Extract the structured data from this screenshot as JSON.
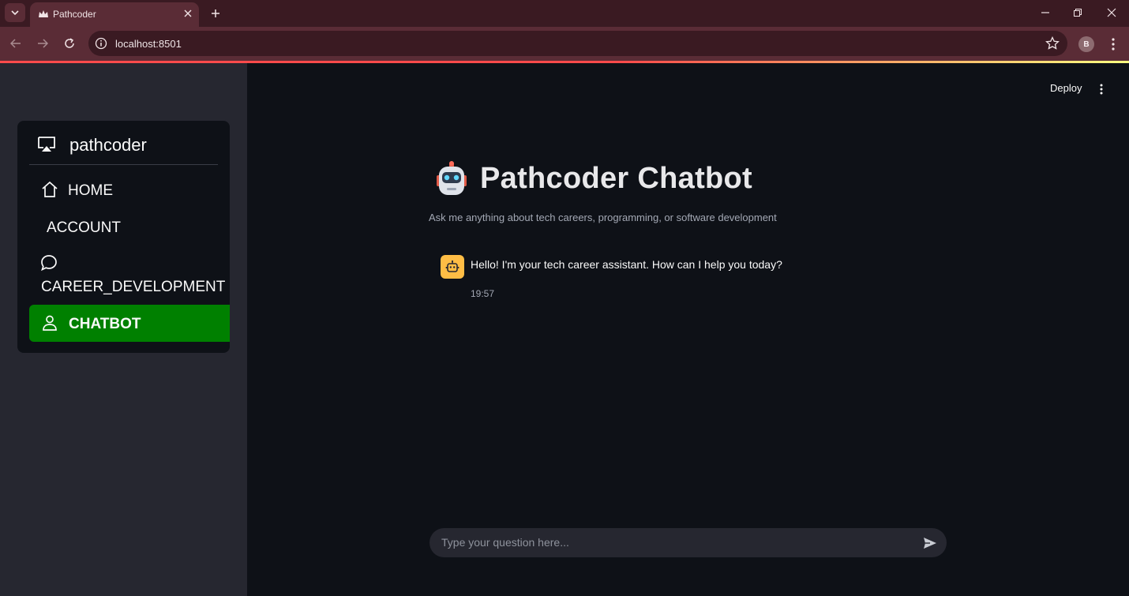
{
  "browser": {
    "tab_title": "Pathcoder",
    "url": "localhost:8501",
    "profile_initial": "B"
  },
  "sidebar": {
    "menu_title": "pathcoder",
    "items": [
      {
        "label": "HOME",
        "icon": "house-icon"
      },
      {
        "label": "ACCOUNT",
        "icon": "none"
      },
      {
        "label": "CAREER_DEVELOPMENT",
        "icon": "chat-bubble-icon"
      },
      {
        "label": "CHATBOT",
        "icon": "person-icon",
        "active": true
      }
    ],
    "active_color": "#008000"
  },
  "header": {
    "deploy_label": "Deploy"
  },
  "main": {
    "title": "Pathcoder Chatbot",
    "subtitle": "Ask me anything about tech careers, programming, or software development",
    "messages": [
      {
        "role": "assistant",
        "text": "Hello! I'm your tech career assistant. How can I help you today?",
        "time": "19:57"
      }
    ],
    "chat_input_placeholder": "Type your question here..."
  },
  "colors": {
    "app_bg": "#0e1117",
    "sidebar_bg": "#262730",
    "browser_chrome": "#5a2c36",
    "assistant_avatar": "#ffbd45"
  }
}
